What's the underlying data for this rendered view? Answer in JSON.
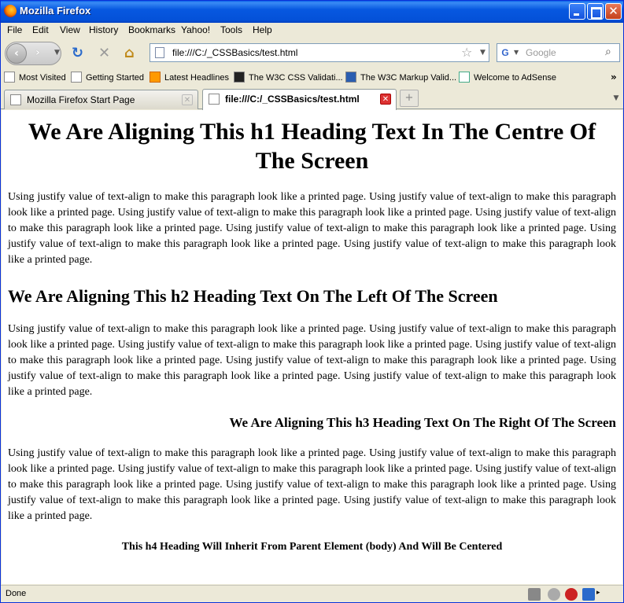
{
  "window": {
    "title": "Mozilla Firefox"
  },
  "menu": [
    "File",
    "Edit",
    "View",
    "History",
    "Bookmarks",
    "Yahoo!",
    "Tools",
    "Help"
  ],
  "navbar": {
    "url": "file:///C:/_CSSBasics/test.html",
    "search_placeholder": "Google"
  },
  "bookmarks": [
    "Most Visited",
    "Getting Started",
    "Latest Headlines",
    "The W3C CSS Validati...",
    "The W3C Markup Valid...",
    "Welcome to AdSense"
  ],
  "tabs": [
    {
      "label": "Mozilla Firefox Start Page",
      "active": false
    },
    {
      "label": "file:///C:/_CSSBasics/test.html",
      "active": true
    }
  ],
  "page": {
    "h1": "We Are Aligning This h1 Heading Text In The Centre Of The Screen",
    "p1": "Using justify value of text-align to make this paragraph look like a printed page. Using justify value of text-align to make this paragraph look like a printed page. Using justify value of text-align to make this paragraph look like a printed page. Using justify value of text-align to make this paragraph look like a printed page. Using justify value of text-align to make this paragraph look like a printed page. Using justify value of text-align to make this paragraph look like a printed page. Using justify value of text-align to make this paragraph look like a printed page.",
    "h2": "We Are Aligning This h2 Heading Text On The Left Of The Screen",
    "p2": "Using justify value of text-align to make this paragraph look like a printed page. Using justify value of text-align to make this paragraph look like a printed page. Using justify value of text-align to make this paragraph look like a printed page. Using justify value of text-align to make this paragraph look like a printed page. Using justify value of text-align to make this paragraph look like a printed page. Using justify value of text-align to make this paragraph look like a printed page. Using justify value of text-align to make this paragraph look like a printed page.",
    "h3": "We Are Aligning This h3 Heading Text On The Right Of The Screen",
    "p3": "Using justify value of text-align to make this paragraph look like a printed page. Using justify value of text-align to make this paragraph look like a printed page. Using justify value of text-align to make this paragraph look like a printed page. Using justify value of text-align to make this paragraph look like a printed page. Using justify value of text-align to make this paragraph look like a printed page. Using justify value of text-align to make this paragraph look like a printed page. Using justify value of text-align to make this paragraph look like a printed page.",
    "h4": "This h4 Heading Will Inherit From Parent Element (body) And Will Be Centered"
  },
  "status": {
    "text": "Done"
  }
}
